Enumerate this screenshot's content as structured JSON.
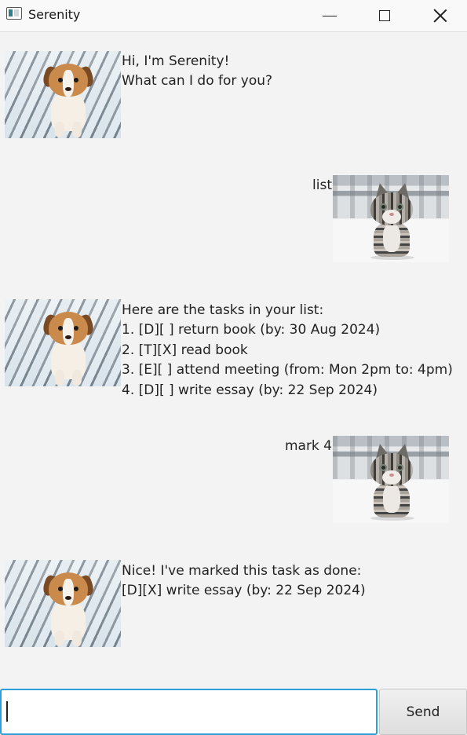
{
  "window": {
    "title": "Serenity"
  },
  "messages": [
    {
      "sender": "serenity",
      "avatar": "puppy-avatar",
      "lines": [
        "Hi, I'm Serenity!",
        "What can I do for you?"
      ]
    },
    {
      "sender": "user",
      "avatar": "kitten-avatar",
      "lines": [
        "list"
      ]
    },
    {
      "sender": "serenity",
      "avatar": "puppy-avatar",
      "lines": [
        "Here are the tasks in your list:",
        "1. [D][ ] return book (by: 30 Aug 2024)",
        "2. [T][X] read book",
        "3. [E][ ] attend meeting (from: Mon 2pm to: 4pm)",
        "4. [D][ ] write essay (by: 22 Sep 2024)"
      ]
    },
    {
      "sender": "user",
      "avatar": "kitten-avatar",
      "lines": [
        "mark 4"
      ]
    },
    {
      "sender": "serenity",
      "avatar": "puppy-avatar",
      "lines": [
        "Nice! I've marked this task as done:",
        "[D][X] write essay (by: 22 Sep 2024)"
      ]
    }
  ],
  "input": {
    "value": "",
    "placeholder": ""
  },
  "send_button": {
    "label": "Send"
  },
  "colors": {
    "background": "#f3f3f3",
    "input_focus_border": "#2f9fd8"
  }
}
